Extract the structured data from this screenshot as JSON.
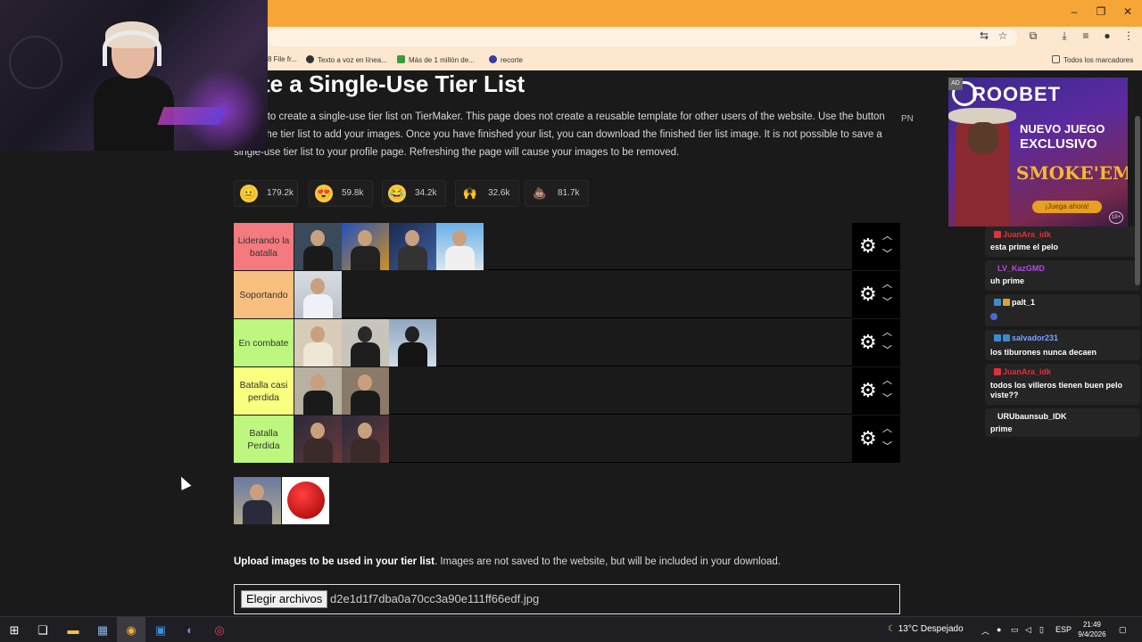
{
  "browser": {
    "controls": {
      "minimize": "–",
      "maximize": "❐",
      "close": "✕"
    },
    "bookmarks": [
      {
        "label": "8 File fr...",
        "color": "#888888"
      },
      {
        "label": "Texto a voz en línea...",
        "color": "#333333"
      },
      {
        "label": "Más de 1 millón de...",
        "color": "#3c9a3c"
      },
      {
        "label": "recorte",
        "color": "#3a3aa0"
      }
    ],
    "all_bookmarks": "Todos los marcadores"
  },
  "page": {
    "title": "eate a Single-Use Tier List",
    "description": "s page to create a single-use tier list on TierMaker. This page does not create a reusable template for other users of the website. Use the button below the tier list to add your images. Once you have finished your list, you can download the finished tier list image. It is not possible to save a single-use tier list to your profile page. Refreshing the page will cause your images to be removed.",
    "pn": "PN",
    "reactions": [
      {
        "icon": "neutral-face-icon",
        "emoji": "😐",
        "count": "179.2k"
      },
      {
        "icon": "heart-eyes-icon",
        "emoji": "😍",
        "count": "59.8k"
      },
      {
        "icon": "laughing-icon",
        "emoji": "😂",
        "count": "34.2k"
      },
      {
        "icon": "raised-hands-icon",
        "emoji": "🙌",
        "count": "32.6k"
      },
      {
        "icon": "poop-icon",
        "emoji": "💩",
        "count": "81.7k"
      }
    ],
    "tiers": [
      {
        "label": "Liderando la batalla",
        "color": "#f47a7f",
        "items": 4
      },
      {
        "label": "Soportando",
        "color": "#f9bf7f",
        "items": 1
      },
      {
        "label": "En combate",
        "color": "#bdf77f",
        "items": 3
      },
      {
        "label": "Batalla casi perdida",
        "color": "#f9ff7f",
        "items": 2
      },
      {
        "label": "Batalla Perdida",
        "color": "#bdf77f",
        "items": 2
      }
    ],
    "upload_bold": "Upload images to be used in your tier list",
    "upload_text": ". Images are not saved to the website, but will be included in your download.",
    "file_button": "Elegir archivos",
    "file_name": "d2e1d1f7dba0a70cc3a90e111ff66edf.jpg"
  },
  "ad": {
    "tag": "AD",
    "brand": "ROOBET",
    "line1": "NUEVO JUEGO",
    "line2": "EXCLUSIVO",
    "line3": "SMOKE'EM",
    "cta": "¡Juega ahora!",
    "age": "18+"
  },
  "chat": [
    {
      "user": "JuanAra_idk",
      "color": "#e0303a",
      "text": "esta prime el pelo"
    },
    {
      "user": "LV_KazGMD",
      "color": "#b04ae0",
      "text": "uh prime"
    },
    {
      "user": "palt_1",
      "color": "#ffffff",
      "text": ""
    },
    {
      "user": "salvador231",
      "color": "#7aa0ff",
      "text": "los tiburones nunca decaen"
    },
    {
      "user": "JuanAra_idk",
      "color": "#e0303a",
      "text": "todos los villeros tienen buen pelo viste??"
    },
    {
      "user": "URUbaunsub_IDK",
      "color": "#ffffff",
      "text": "prime"
    }
  ],
  "taskbar": {
    "weather": "13°C  Despejado",
    "lang": "ESP",
    "time": "21:49",
    "date": "9/4/2026"
  }
}
